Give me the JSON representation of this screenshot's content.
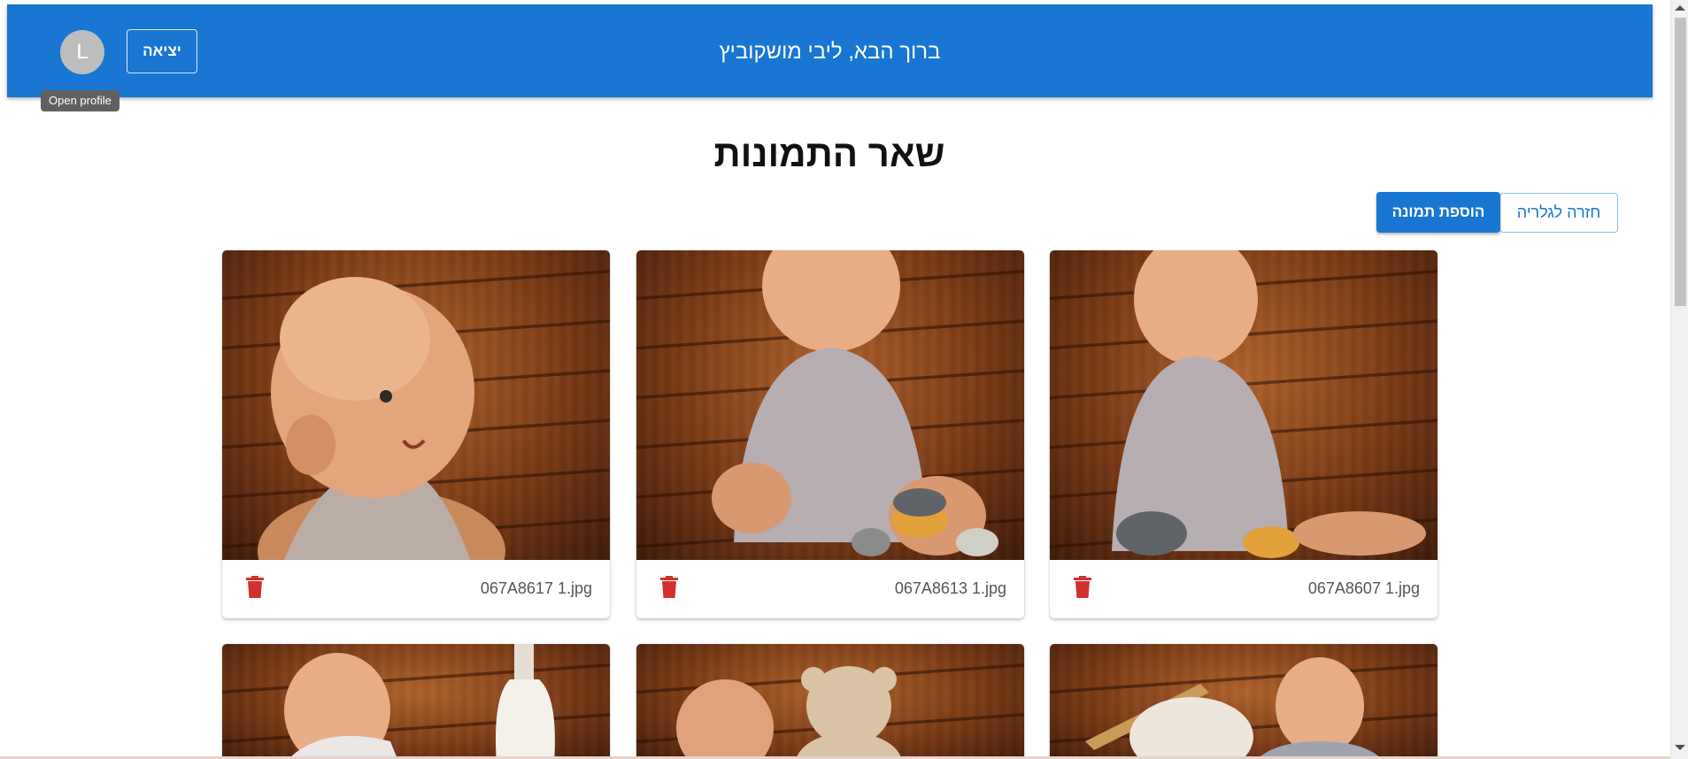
{
  "header": {
    "welcome": "ברוך הבא, ליבי מושקוביץ",
    "logout_label": "יציאה",
    "avatar_letter": "L",
    "avatar_tooltip": "Open profile",
    "color": "#1976d2"
  },
  "main": {
    "title": "שאר התמונות",
    "back_to_gallery_label": "חזרה לגלריה",
    "add_image_label": "הוספת תמונה"
  },
  "images": [
    {
      "filename": "067A8617 1.jpg",
      "icon": "trash-icon"
    },
    {
      "filename": "067A8613 1.jpg",
      "icon": "trash-icon"
    },
    {
      "filename": "067A8607 1.jpg",
      "icon": "trash-icon"
    }
  ],
  "colors": {
    "accent": "#1976d2",
    "delete": "#d32f2f"
  }
}
